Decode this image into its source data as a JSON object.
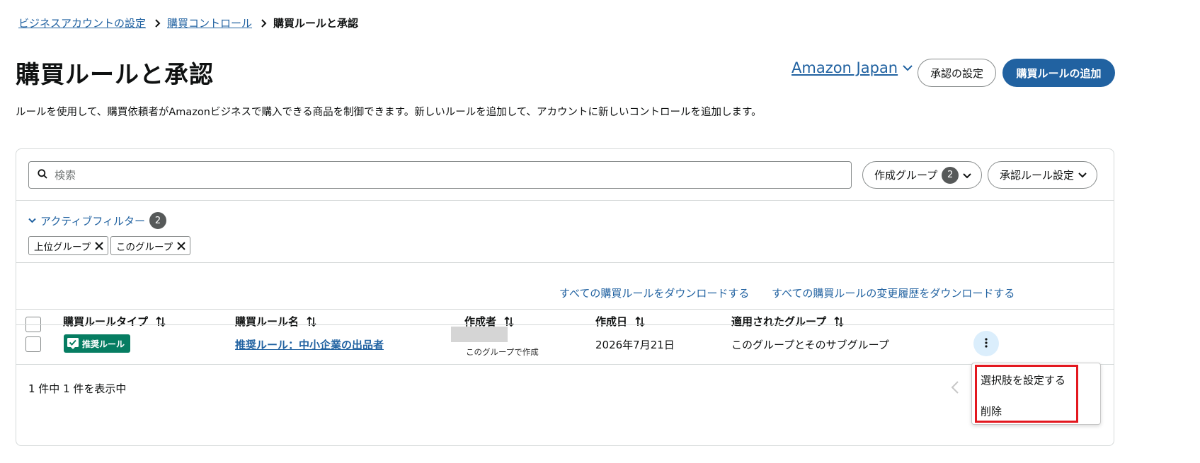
{
  "breadcrumb": {
    "items": [
      "ビジネスアカウントの設定",
      "購買コントロール"
    ],
    "current": "購買ルールと承認"
  },
  "page": {
    "title": "購買ルールと承認",
    "description": "ルールを使用して、購買依頼者がAmazonビジネスで購入できる商品を制御できます。新しいルールを追加して、アカウントに新しいコントロールを追加します。"
  },
  "header": {
    "org_name": "Amazon Japan",
    "approval_settings_label": "承認の設定",
    "add_rule_label": "購買ルールの追加"
  },
  "toolbar": {
    "search_placeholder": "検索",
    "created_group_label": "作成グループ",
    "created_group_count": "2",
    "approval_rule_setting_label": "承認ルール設定"
  },
  "filters": {
    "toggle_label": "アクティブフィルター",
    "count": "2",
    "chips": [
      "上位グループ",
      "このグループ"
    ]
  },
  "downloads": {
    "all_rules": "すべての購買ルールをダウンロードする",
    "all_history": "すべての購買ルールの変更履歴をダウンロードする"
  },
  "table": {
    "columns": [
      "購買ルールタイプ",
      "購買ルール名",
      "作成者",
      "作成日",
      "適用されたグループ"
    ],
    "rows": [
      {
        "type_badge": "推奨ルール",
        "name": "推奨ルール：中小企業の出品者",
        "creator_note": "このグループで作成",
        "created_date": "2026年7月21日",
        "applied_group": "このグループとそのサブグループ"
      }
    ]
  },
  "footer": {
    "count_text": "1 件中 1 件を表示中"
  },
  "row_menu": {
    "items": [
      "選択肢を設定する",
      "削除"
    ]
  },
  "colors": {
    "link": "#2162a1",
    "primary_button": "#2162a1",
    "badge": "#067d62",
    "highlight": "#e3181f"
  }
}
